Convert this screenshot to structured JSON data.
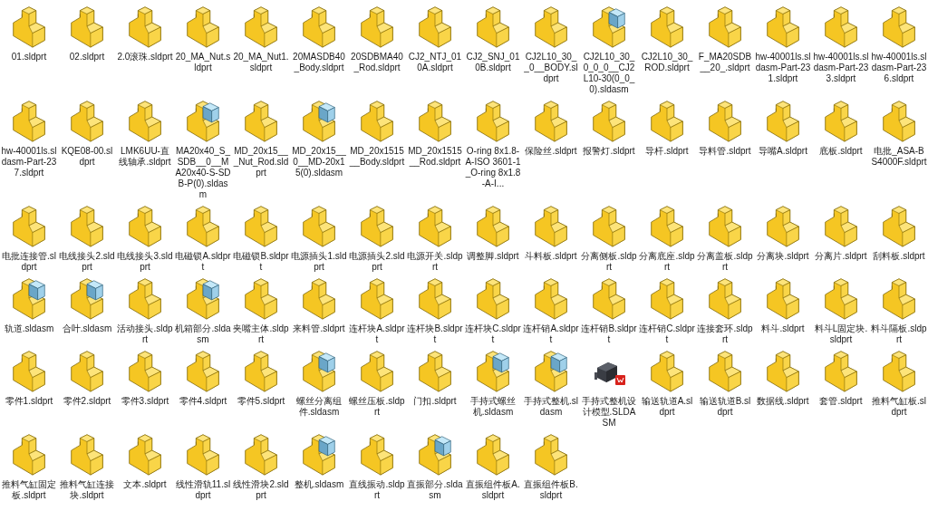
{
  "files": [
    {
      "name": "01.sldprt",
      "kind": "part"
    },
    {
      "name": "02.sldprt",
      "kind": "part"
    },
    {
      "name": "2.0滚珠.sldprt",
      "kind": "part"
    },
    {
      "name": "20_MA_Nut.sldprt",
      "kind": "part"
    },
    {
      "name": "20_MA_Nut1.sldprt",
      "kind": "part"
    },
    {
      "name": "20MASDB40_Body.sldprt",
      "kind": "part"
    },
    {
      "name": "20SDBMA40_Rod.sldprt",
      "kind": "part"
    },
    {
      "name": "CJ2_NTJ_010A.sldprt",
      "kind": "part"
    },
    {
      "name": "CJ2_SNJ_010B.sldprt",
      "kind": "part"
    },
    {
      "name": "CJ2L10_30__0__BODY.sldprt",
      "kind": "part"
    },
    {
      "name": "CJ2L10_30_0_0_0__CJ2L10-30(0_0_0).sldasm",
      "kind": "assembly"
    },
    {
      "name": "CJ2L10_30_ROD.sldprt",
      "kind": "part"
    },
    {
      "name": "F_MA20SDB__20_.sldprt",
      "kind": "part"
    },
    {
      "name": "hw-40001ls.sldasm-Part-231.sldprt",
      "kind": "part"
    },
    {
      "name": "hw-40001ls.sldasm-Part-233.sldprt",
      "kind": "part"
    },
    {
      "name": "hw-40001ls.sldasm-Part-236.sldprt",
      "kind": "part"
    },
    {
      "name": "hw-40001ls.sldasm-Part-237.sldprt",
      "kind": "part"
    },
    {
      "name": "KQE08-00.sldprt",
      "kind": "part"
    },
    {
      "name": "LMK6UU-直线轴承.sldprt",
      "kind": "part"
    },
    {
      "name": "MA20x40_S_SDB__0__MA20x40-S-SDB-P(0).sldasm",
      "kind": "assembly"
    },
    {
      "name": "MD_20x15___Nut_Rod.sldprt",
      "kind": "part"
    },
    {
      "name": "MD_20x15__0__MD-20x15(0).sldasm",
      "kind": "assembly"
    },
    {
      "name": "MD_20x1515__Body.sldprt",
      "kind": "part"
    },
    {
      "name": "MD_20x1515__Rod.sldprt",
      "kind": "part"
    },
    {
      "name": "O-ring 8x1.8-A-ISO 3601-1_O-ring 8x1.8-A-I...",
      "kind": "part"
    },
    {
      "name": "保险丝.sldprt",
      "kind": "part"
    },
    {
      "name": "报警灯.sldprt",
      "kind": "part"
    },
    {
      "name": "导杆.sldprt",
      "kind": "part"
    },
    {
      "name": "导料管.sldprt",
      "kind": "part"
    },
    {
      "name": "导嘴A.sldprt",
      "kind": "part"
    },
    {
      "name": "底板.sldprt",
      "kind": "part"
    },
    {
      "name": "电批_ASA-BS4000F.sldprt",
      "kind": "part"
    },
    {
      "name": "电批连接管.sldprt",
      "kind": "part"
    },
    {
      "name": "电线接头2.sldprt",
      "kind": "part"
    },
    {
      "name": "电线接头3.sldprt",
      "kind": "part"
    },
    {
      "name": "电磁锁A.sldprt",
      "kind": "part"
    },
    {
      "name": "电磁锁B.sldprt",
      "kind": "part"
    },
    {
      "name": "电源插头1.sldprt",
      "kind": "part"
    },
    {
      "name": "电源插头2.sldprt",
      "kind": "part"
    },
    {
      "name": "电源开关.sldprt",
      "kind": "part"
    },
    {
      "name": "调整脚.sldprt",
      "kind": "part"
    },
    {
      "name": "斗料板.sldprt",
      "kind": "part"
    },
    {
      "name": "分离侧板.sldprt",
      "kind": "part"
    },
    {
      "name": "分离底座.sldprt",
      "kind": "part"
    },
    {
      "name": "分离盖板.sldprt",
      "kind": "part"
    },
    {
      "name": "分离块.sldprt",
      "kind": "part"
    },
    {
      "name": "分离片.sldprt",
      "kind": "part"
    },
    {
      "name": "刮料板.sldprt",
      "kind": "part"
    },
    {
      "name": "轨道.sldasm",
      "kind": "assembly"
    },
    {
      "name": "合叶.sldasm",
      "kind": "assembly"
    },
    {
      "name": "活动接头.sldprt",
      "kind": "part"
    },
    {
      "name": "机箱部分.sldasm",
      "kind": "assembly"
    },
    {
      "name": "夹嘴主体.sldprt",
      "kind": "part"
    },
    {
      "name": "来料管.sldprt",
      "kind": "part"
    },
    {
      "name": "连杆块A.sldprt",
      "kind": "part"
    },
    {
      "name": "连杆块B.sldprt",
      "kind": "part"
    },
    {
      "name": "连杆块C.sldprt",
      "kind": "part"
    },
    {
      "name": "连杆销A.sldprt",
      "kind": "part"
    },
    {
      "name": "连杆销B.sldprt",
      "kind": "part"
    },
    {
      "name": "连杆销C.sldprt",
      "kind": "part"
    },
    {
      "name": "连接套环.sldprt",
      "kind": "part"
    },
    {
      "name": "料斗.sldprt",
      "kind": "part"
    },
    {
      "name": "料斗L固定块.sldprt",
      "kind": "part"
    },
    {
      "name": "料斗隔板.sldprt",
      "kind": "part"
    },
    {
      "name": "零件1.sldprt",
      "kind": "part"
    },
    {
      "name": "零件2.sldprt",
      "kind": "part"
    },
    {
      "name": "零件3.sldprt",
      "kind": "part"
    },
    {
      "name": "零件4.sldprt",
      "kind": "part"
    },
    {
      "name": "零件5.sldprt",
      "kind": "part"
    },
    {
      "name": "螺丝分离组件.sldasm",
      "kind": "assembly"
    },
    {
      "name": "螺丝压板.sldprt",
      "kind": "part"
    },
    {
      "name": "门扣.sldprt",
      "kind": "part"
    },
    {
      "name": "手持式螺丝机.sldasm",
      "kind": "assembly"
    },
    {
      "name": "手持式整机.sldasm",
      "kind": "assembly"
    },
    {
      "name": "手持式整机设计模型.SLDASM",
      "kind": "thumbnail"
    },
    {
      "name": "输送轨道A.sldprt",
      "kind": "part"
    },
    {
      "name": "输送轨道B.sldprt",
      "kind": "part"
    },
    {
      "name": "数据线.sldprt",
      "kind": "part"
    },
    {
      "name": "套管.sldprt",
      "kind": "part"
    },
    {
      "name": "推料气缸板.sldprt",
      "kind": "part"
    },
    {
      "name": "推料气缸固定板.sldprt",
      "kind": "part"
    },
    {
      "name": "推料气缸连接块.sldprt",
      "kind": "part"
    },
    {
      "name": "文本.sldprt",
      "kind": "part"
    },
    {
      "name": "线性滑轨11.sldprt",
      "kind": "part"
    },
    {
      "name": "线性滑块2.sldprt",
      "kind": "part"
    },
    {
      "name": "整机.sldasm",
      "kind": "assembly"
    },
    {
      "name": "直线振动.sldprt",
      "kind": "part"
    },
    {
      "name": "直振部分.sldasm",
      "kind": "assembly"
    },
    {
      "name": "直振组件板A.sldprt",
      "kind": "part"
    },
    {
      "name": "直振组件板B.sldprt",
      "kind": "part"
    }
  ]
}
